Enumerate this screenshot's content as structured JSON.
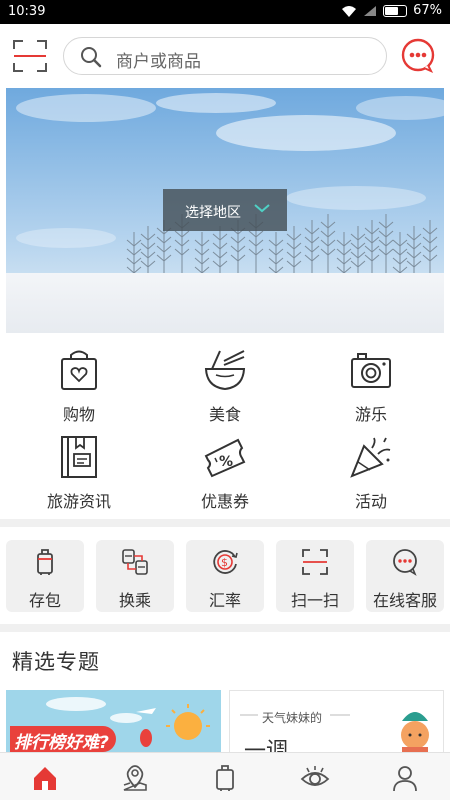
{
  "status_bar": {
    "time": "10:39",
    "battery": "67%",
    "battery_level": 0.67
  },
  "search": {
    "placeholder": "商户或商品"
  },
  "banner": {
    "region_label": "选择地区"
  },
  "categories": [
    {
      "label": "购物",
      "icon": "shopping-bag-icon"
    },
    {
      "label": "美食",
      "icon": "food-bowl-icon"
    },
    {
      "label": "游乐",
      "icon": "camera-icon"
    },
    {
      "label": "旅游资讯",
      "icon": "travel-info-icon"
    },
    {
      "label": "优惠券",
      "icon": "coupon-icon"
    },
    {
      "label": "活动",
      "icon": "party-icon"
    }
  ],
  "tools": [
    {
      "label": "存包",
      "icon": "luggage-icon"
    },
    {
      "label": "换乘",
      "icon": "transfer-icon"
    },
    {
      "label": "汇率",
      "icon": "exchange-rate-icon"
    },
    {
      "label": "扫一扫",
      "icon": "scan-icon"
    },
    {
      "label": "在线客服",
      "icon": "chat-icon"
    }
  ],
  "featured": {
    "title": "精选专题",
    "cards": [
      {
        "text": "排行榜好难?"
      },
      {
        "subtitle": "天气妹妹的",
        "text": "一调"
      }
    ]
  },
  "bottom_nav": [
    {
      "name": "home-icon",
      "active": true
    },
    {
      "name": "location-icon"
    },
    {
      "name": "luggage-icon"
    },
    {
      "name": "eye-icon"
    },
    {
      "name": "profile-icon"
    }
  ],
  "colors": {
    "accent": "#e53935",
    "teal": "#4fd1c5",
    "text": "#333333"
  }
}
